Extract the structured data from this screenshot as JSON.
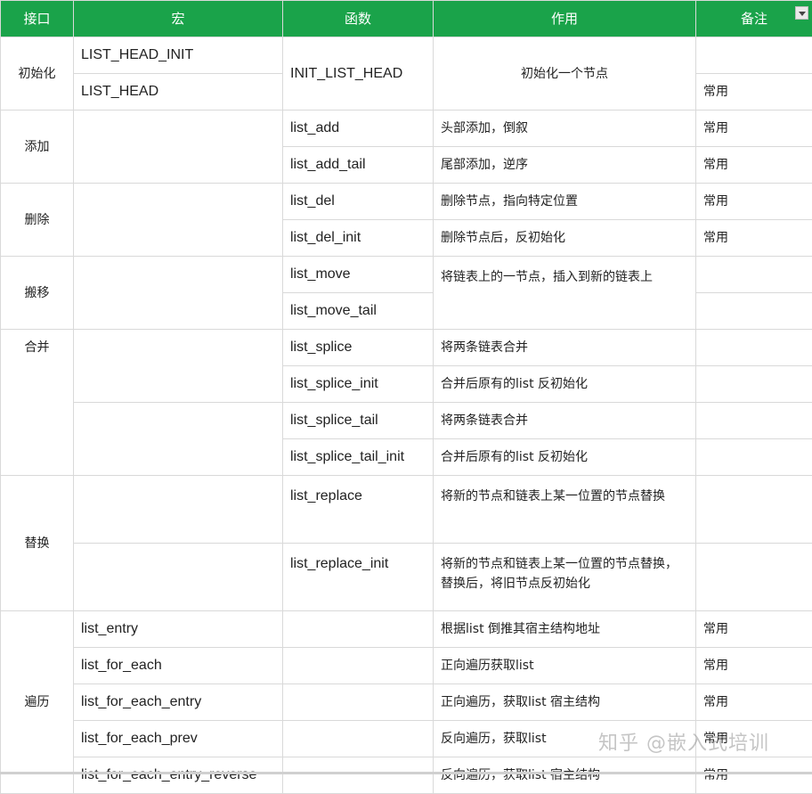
{
  "header": {
    "col_interface": "接口",
    "col_macro": "宏",
    "col_function": "函数",
    "col_usage": "作用",
    "col_note": "备注"
  },
  "groups": {
    "init": {
      "label": "初始化",
      "macro1": "LIST_HEAD_INIT",
      "macro2": "LIST_HEAD",
      "function": "INIT_LIST_HEAD",
      "usage": "初始化一个节点",
      "note2": "常用"
    },
    "add": {
      "label": "添加",
      "rows": [
        {
          "function": "list_add",
          "usage": "头部添加，倒叙",
          "note": "常用"
        },
        {
          "function": "list_add_tail",
          "usage": "尾部添加，逆序",
          "note": "常用"
        }
      ]
    },
    "del": {
      "label": "删除",
      "rows": [
        {
          "function": "list_del",
          "usage": "删除节点，指向特定位置",
          "note": "常用"
        },
        {
          "function": "list_del_init",
          "usage": "删除节点后，反初始化",
          "note": "常用"
        }
      ]
    },
    "move": {
      "label": "搬移",
      "rows": [
        {
          "function": "list_move"
        },
        {
          "function": "list_move_tail"
        }
      ],
      "usage": "将链表上的一节点，插入到新的链表上"
    },
    "splice": {
      "label": "合并",
      "rows": [
        {
          "function": "list_splice",
          "usage": "将两条链表合并"
        },
        {
          "function": "list_splice_init",
          "usage": "合并后原有的list 反初始化"
        },
        {
          "function": "list_splice_tail",
          "usage": "将两条链表合并"
        },
        {
          "function": "list_splice_tail_init",
          "usage": "合并后原有的list 反初始化"
        }
      ]
    },
    "replace": {
      "label": "替换",
      "rows": [
        {
          "function": "list_replace",
          "usage": "将新的节点和链表上某一位置的节点替换"
        },
        {
          "function": "list_replace_init",
          "usage": "将新的节点和链表上某一位置的节点替换，替换后，将旧节点反初始化"
        }
      ]
    },
    "iterate": {
      "label": "遍历",
      "rows": [
        {
          "macro": "list_entry",
          "usage": "根据list 倒推其宿主结构地址",
          "note": "常用"
        },
        {
          "macro": "list_for_each",
          "usage": "正向遍历获取list",
          "note": "常用"
        },
        {
          "macro": "list_for_each_entry",
          "usage": "正向遍历，获取list 宿主结构",
          "note": "常用"
        },
        {
          "macro": "list_for_each_prev",
          "usage": "反向遍历，获取list",
          "note": "常用"
        },
        {
          "macro": "list_for_each_entry_reverse",
          "usage": "反向遍历，获取list 宿主结构",
          "note": "常用"
        }
      ]
    }
  },
  "watermark": "知乎 @嵌入式培训",
  "colors": {
    "header_bg": "#1aa34a",
    "border": "#d9d9d9"
  },
  "icons": {
    "header_dropdown": "dropdown-arrow-icon"
  }
}
